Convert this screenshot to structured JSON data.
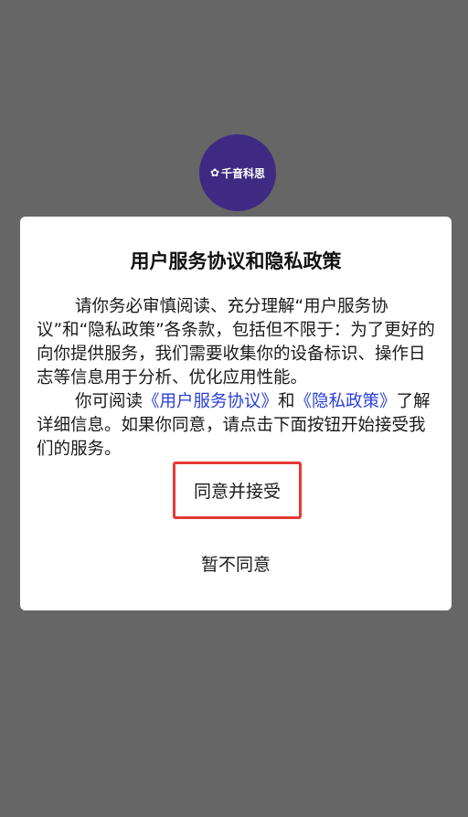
{
  "logo": {
    "text": "千音科思"
  },
  "dialog": {
    "title": "用户服务协议和隐私政策",
    "paragraph1": "请你务必审慎阅读、充分理解“用户服务协议”和“隐私政策”各条款，包括但不限于：为了更好的向你提供服务，我们需要收集你的设备标识、操作日志等信息用于分析、优化应用性能。",
    "paragraph2": {
      "prefix": "你可阅读",
      "service_link": "《用户服务协议》",
      "conjunction": "和",
      "privacy_link": "《隐私政策》",
      "suffix": "了解详细信息。如果你同意，请点击下面按钮开始接受我们的服务。"
    },
    "agree_label": "同意并接受",
    "disagree_label": "暂不同意"
  },
  "colors": {
    "backdrop": "#666666",
    "dialog": "#ffffff",
    "link": "#2a3fd6",
    "highlight_border": "#e53935",
    "logo_bg": "#3e2a82"
  }
}
